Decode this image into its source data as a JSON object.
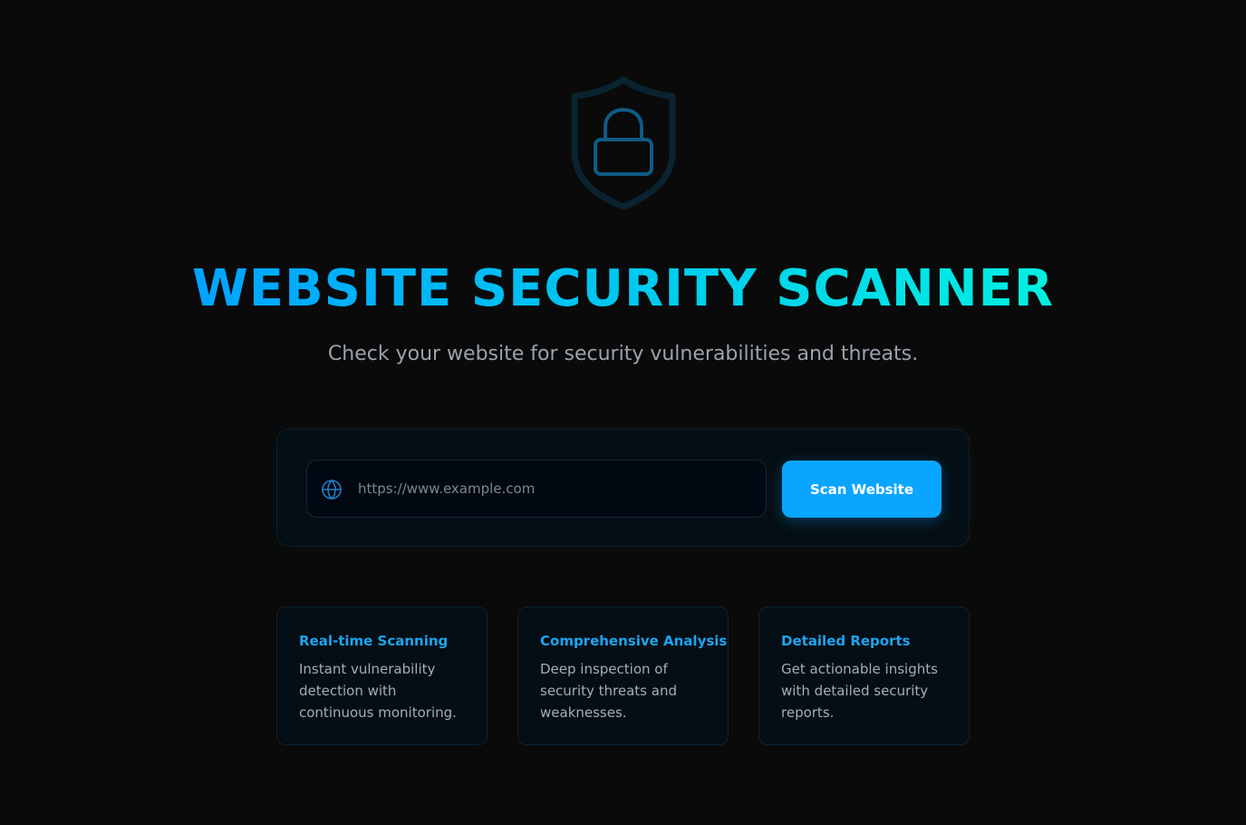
{
  "header": {
    "title": "WEBSITE SECURITY SCANNER",
    "subtitle": "Check your website for security vulnerabilities and threats."
  },
  "scan_form": {
    "url_value": "",
    "url_placeholder": "https://www.example.com",
    "scan_button_label": "Scan Website",
    "field_icon": "globe-icon"
  },
  "features": [
    {
      "title": "Real-time Scanning",
      "description": "Instant vulnerability detection with continuous monitoring."
    },
    {
      "title": "Comprehensive Analysis",
      "description": "Deep inspection of security threats and weaknesses."
    },
    {
      "title": "Detailed Reports",
      "description": "Get actionable insights with detailed security reports."
    }
  ],
  "icons": {
    "hero": "shield-lock-icon",
    "field": "globe-icon"
  },
  "colors": {
    "background": "#0a0a0a",
    "accent": "#0aa5ff",
    "title_gradient_start": "#00a3ff",
    "title_gradient_end": "#00f0e0",
    "card_title": "#1fa4f0"
  }
}
